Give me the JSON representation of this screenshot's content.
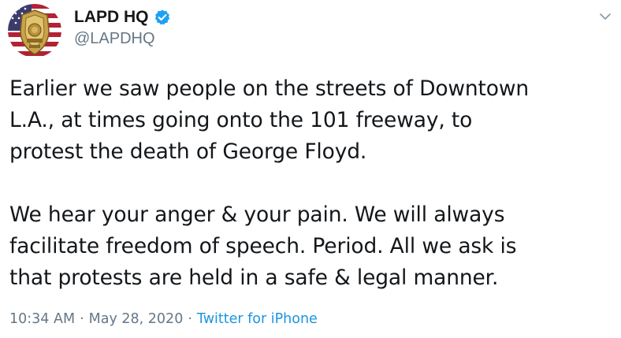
{
  "user": {
    "display_name": "LAPD HQ",
    "handle": "@LAPDHQ",
    "verified": true
  },
  "icons": {
    "avatar": "lapd-badge-avatar",
    "verified": "verified-badge-icon",
    "menu": "chevron-down-icon"
  },
  "tweet": {
    "paragraphs": [
      "Earlier we saw people on the streets of Downtown\nL.A., at times going onto the 101 freeway, to\nprotest the death of George Floyd.",
      "We hear your anger & your pain. We will always\nfacilitate freedom of speech. Period. All we ask is\nthat protests are held in a safe & legal manner."
    ],
    "time": "10:34 AM",
    "date": "May 28, 2020",
    "separator": "·",
    "source": "Twitter for iPhone"
  },
  "colors": {
    "verified_blue": "#1da1f2",
    "link_blue": "#1b95e0",
    "secondary_text": "#657786",
    "primary_text": "#14171a"
  }
}
